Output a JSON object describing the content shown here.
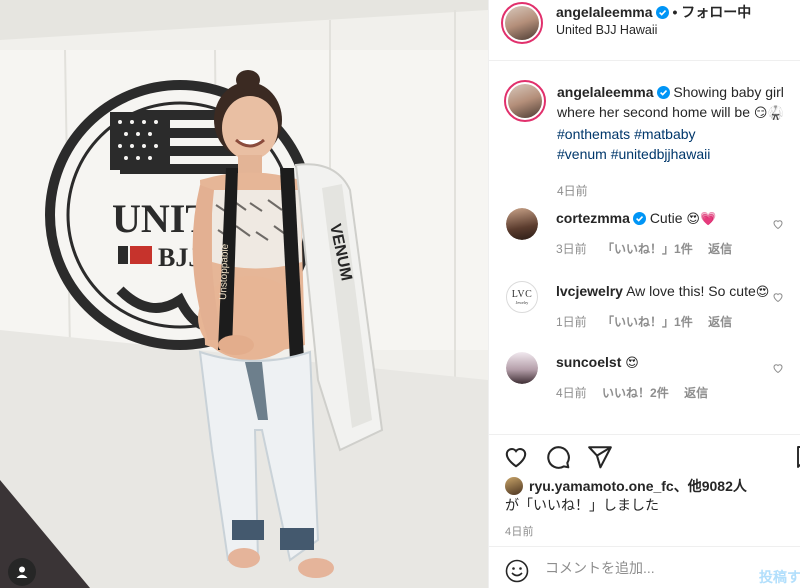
{
  "post": {
    "username": "angelaleemma",
    "follow_text": "• フォロー中",
    "location": "United BJJ Hawaii",
    "caption_text": "Showing baby girl where her second home will be",
    "caption_emoji": "😏🥋",
    "hashtags": [
      "#onthemats",
      "#matbaby",
      "#venum",
      "#unitedbjjhawaii"
    ],
    "caption_time": "4日前"
  },
  "photo": {
    "logo_text_1": "UNIT",
    "logo_text_2": "BJJ",
    "gi_brand": "VENUM",
    "belt_text": "Unstoppable"
  },
  "comments": [
    {
      "username": "cortezmma",
      "text": "Cutie",
      "emoji": "😍💗",
      "time": "3日前",
      "likes": "「いいね！」1件",
      "reply": "返信",
      "verified": true
    },
    {
      "username": "lvcjewelry",
      "text": "Aw love this! So cute",
      "emoji": "😍",
      "time": "1日前",
      "likes": "「いいね！」1件",
      "reply": "返信",
      "avatar_big": "LVC",
      "avatar_small": "Jewelry",
      "verified": false
    },
    {
      "username": "suncoelst",
      "text": "",
      "emoji": "😍",
      "time": "4日前",
      "likes": "いいね！2件",
      "reply": "返信",
      "verified": false
    }
  ],
  "likes": {
    "user": "ryu.yamamoto.one_fc",
    "others": "、他9082人",
    "line2": "が「いいね！」しました"
  },
  "post_date": "4日前",
  "add_comment": {
    "placeholder": "コメントを追加...",
    "post_label": "投稿する"
  },
  "icons": [
    "heart-icon",
    "comment-icon",
    "share-icon",
    "bookmark-icon",
    "emoji-icon",
    "verified-icon",
    "user-tag-icon"
  ],
  "colors": {
    "verified": "#0095f6",
    "hashtag": "#00376b",
    "post_button": "#b2dffc",
    "muted": "#8e8e8e"
  }
}
